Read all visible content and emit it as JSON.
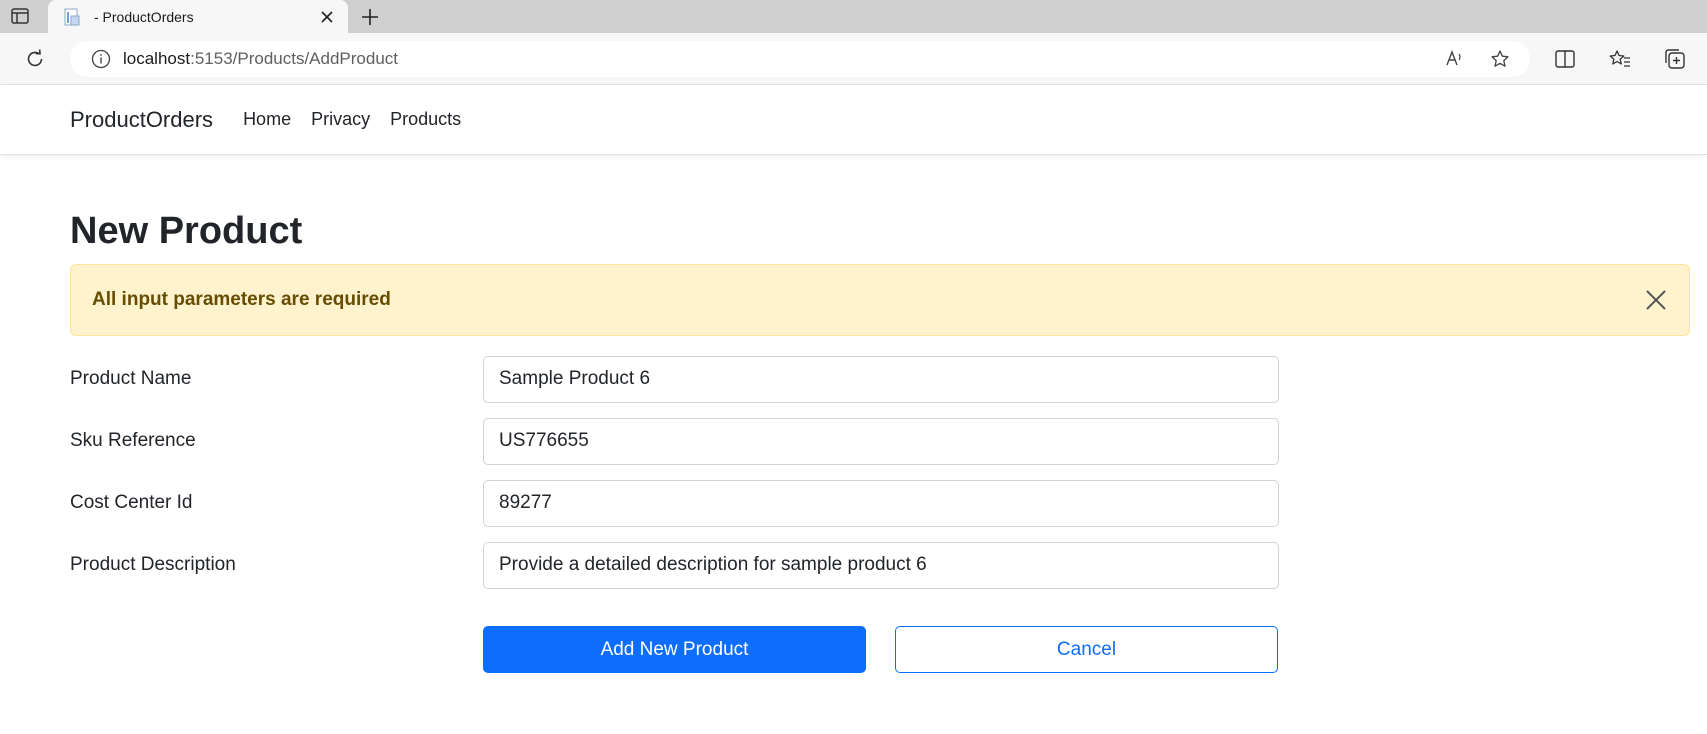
{
  "browser": {
    "tab_title": "- ProductOrders",
    "url_host": "localhost",
    "url_rest": ":5153/Products/AddProduct"
  },
  "navbar": {
    "brand": "ProductOrders",
    "links": [
      "Home",
      "Privacy",
      "Products"
    ]
  },
  "page": {
    "title": "New Product",
    "alert": {
      "text": "All input parameters are required",
      "type": "warning"
    },
    "form": {
      "fields": [
        {
          "label": "Product Name",
          "value": "Sample Product 6"
        },
        {
          "label": "Sku Reference",
          "value": "US776655"
        },
        {
          "label": "Cost Center Id",
          "value": "89277"
        },
        {
          "label": "Product Description",
          "value": "Provide a detailed description for sample product 6"
        }
      ],
      "submit_label": "Add New Product",
      "cancel_label": "Cancel"
    }
  },
  "colors": {
    "primary": "#0d6efd",
    "alert_bg": "#fff3cd",
    "alert_text": "#664d03"
  }
}
